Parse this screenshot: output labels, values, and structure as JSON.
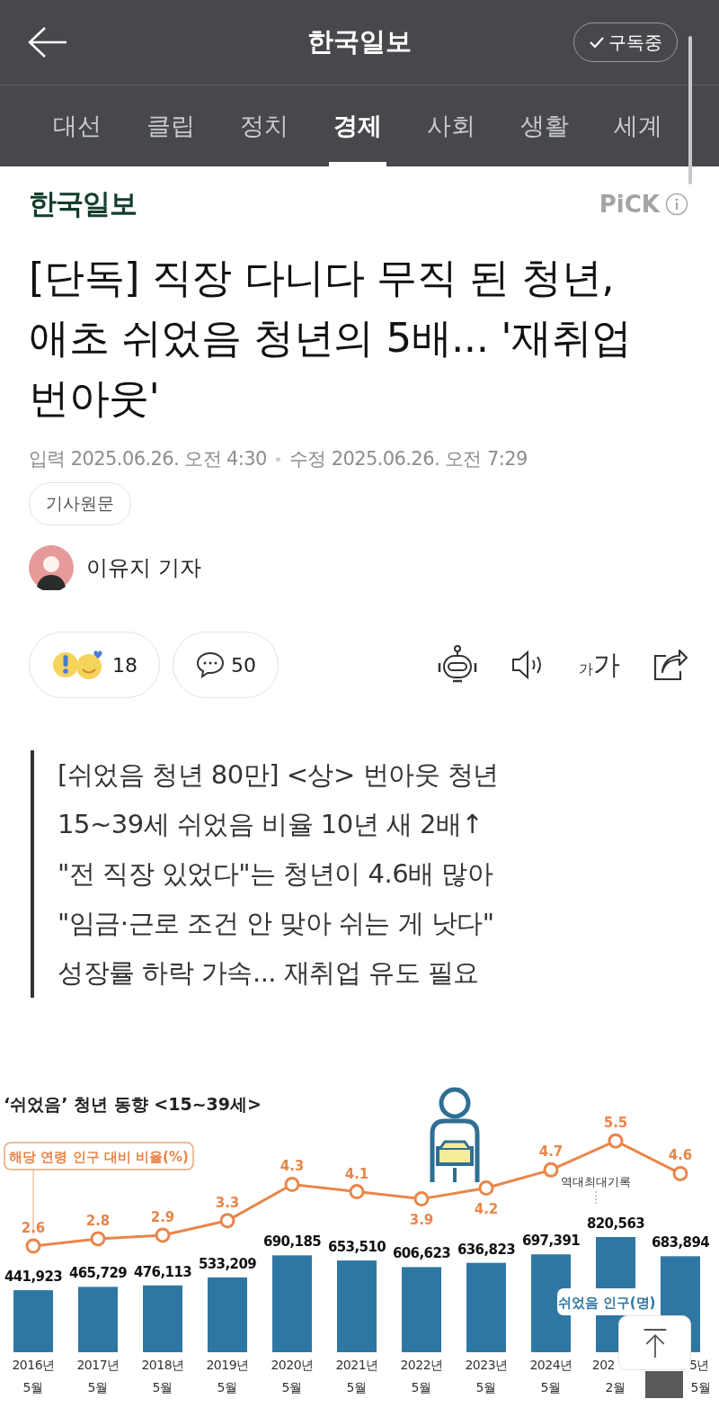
{
  "header": {
    "title": "한국일보",
    "subscribe": {
      "label": "구독중",
      "subscribed": true
    }
  },
  "tabs": [
    {
      "label": "대선",
      "selected": false
    },
    {
      "label": "클립",
      "selected": false
    },
    {
      "label": "정치",
      "selected": false
    },
    {
      "label": "경제",
      "selected": true
    },
    {
      "label": "사회",
      "selected": false
    },
    {
      "label": "생활",
      "selected": false
    },
    {
      "label": "세계",
      "selected": false
    }
  ],
  "press": {
    "name": "한국일보",
    "badge": "PiCK"
  },
  "article": {
    "headline": "[단독] 직장 다니다 무직 된 청년, 애초 쉬었음 청년의 5배... '재취업 번아웃'",
    "input_label": "입력",
    "input_time": "2025.06.26. 오전 4:30",
    "edit_label": "수정",
    "edit_time": "2025.06.26. 오전 7:29",
    "original_link": "기사원문",
    "reporter": "이유지 기자",
    "reactions": {
      "count": "18"
    },
    "comments": {
      "count": "50"
    },
    "text_size": {
      "small": "가",
      "large": "가"
    },
    "summary": [
      "[쉬었음 청년 80만] <상> 번아웃 청년",
      "15~39세 쉬었음 비율 10년 새 2배↑",
      "\"전 직장 있었다\"는 청년이 4.6배 많아",
      "\"임금·근로 조건 안 맞아 쉬는 게 낫다\"",
      "성장률 하락 가속... 재취업 유도 필요"
    ]
  },
  "infographic": {
    "population_chart": {
      "chart_data": {
        "type": "bar",
        "title": "‘쉬었음’ 청년 동향 <15~39세>",
        "categories": [
          "2016년 5월",
          "2017년 5월",
          "2018년 5월",
          "2019년 5월",
          "2020년 5월",
          "2021년 5월",
          "2022년 5월",
          "2023년 5월",
          "2024년 5월",
          "202 2월",
          "5년 5월"
        ],
        "series": [
          {
            "name": "쉬었음 인구(명)",
            "color": "#2f77a3",
            "values": [
              441923,
              465729,
              476113,
              533209,
              690185,
              653510,
              606623,
              636823,
              697391,
              820563,
              683894
            ],
            "value_labels": [
              "441,923",
              "465,729",
              "476,113",
              "533,209",
              "690,185",
              "653,510",
              "606,623",
              "636,823",
              "697,391",
              "820,563",
              "683,894"
            ]
          }
        ],
        "annotations": [
          "역대최대기록"
        ]
      }
    },
    "ratio_chart": {
      "chart_data": {
        "type": "line",
        "data_labels": true,
        "series": [
          {
            "name": "해당 연령 인구 대비 비율(%)",
            "color": "#e8864a",
            "marker": "circle",
            "values": [
              2.6,
              2.8,
              2.9,
              3.3,
              4.3,
              4.1,
              3.9,
              4.2,
              4.7,
              5.5,
              4.6
            ]
          }
        ]
      }
    }
  }
}
